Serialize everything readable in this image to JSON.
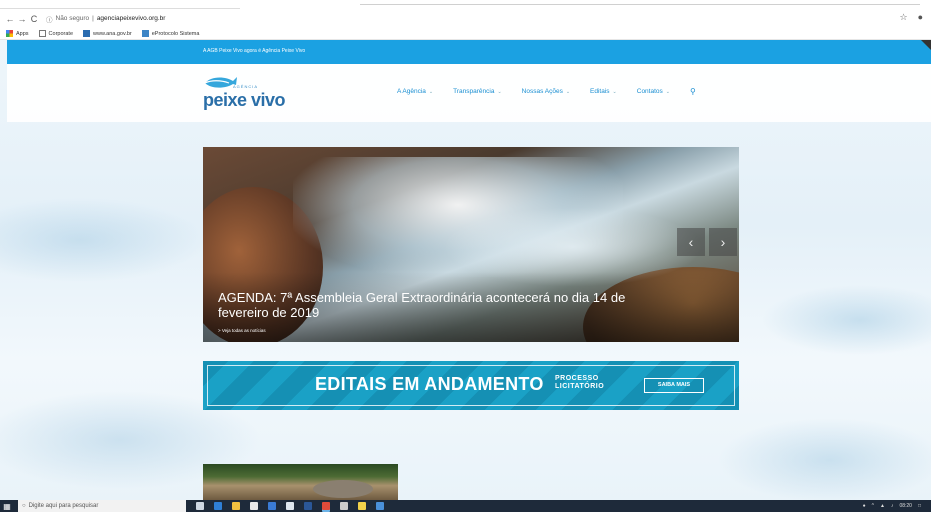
{
  "browser": {
    "nav": {
      "back": "←",
      "forward": "→",
      "reload": "C"
    },
    "security_label": "Não seguro",
    "url": "agenciapeixevivo.org.br",
    "right_icons": [
      "star-icon",
      "profile-icon"
    ],
    "bookmarks": [
      {
        "label": "Apps",
        "icon": "apps-grid-icon",
        "color": "#e94235"
      },
      {
        "label": "Corporate",
        "icon": "page-icon",
        "color": "#777777"
      },
      {
        "label": "www.ana.gov.br",
        "icon": "ana-icon",
        "color": "#2b6cb0"
      },
      {
        "label": "eProtocolo Sistema",
        "icon": "eprotocolo-icon",
        "color": "#3d85c6"
      }
    ]
  },
  "site": {
    "topbar_message": "A AGB Peixe Vivo agora é Agência Peixe Vivo",
    "logo": {
      "small": "AGÊNCIA",
      "name": "peixe vivo"
    },
    "nav": [
      {
        "label": "A Agência",
        "chevron": "⌄"
      },
      {
        "label": "Transparência",
        "chevron": "⌄"
      },
      {
        "label": "Nossas Ações",
        "chevron": "⌄"
      },
      {
        "label": "Editais",
        "chevron": "⌄"
      },
      {
        "label": "Contatos",
        "chevron": "⌄"
      }
    ],
    "slider": {
      "caption": "AGENDA: 7ª Assembleia Geral Extraordinária acontecerá no dia 14 de fevereiro de 2019",
      "more_link": "> Veja todas as notícias",
      "prev": "‹",
      "next": "›"
    },
    "banner": {
      "title": "EDITAIS EM ANDAMENTO",
      "subtitle_line1": "PROCESSO",
      "subtitle_line2": "LICITATÓRIO",
      "button": "SAIBA MAIS"
    }
  },
  "taskbar": {
    "search_placeholder": "Digite aqui para pesquisar",
    "apps": [
      {
        "name": "task-view",
        "color": "#cfd8e3"
      },
      {
        "name": "edge",
        "color": "#2f7fd6"
      },
      {
        "name": "explorer",
        "color": "#f0c040"
      },
      {
        "name": "store",
        "color": "#e8e8e8"
      },
      {
        "name": "outlook",
        "color": "#3a7bd5"
      },
      {
        "name": "skype",
        "color": "#dfe7ef"
      },
      {
        "name": "word",
        "color": "#2b5797"
      },
      {
        "name": "chrome",
        "color": "#e04b3a"
      },
      {
        "name": "calculator",
        "color": "#cccccc"
      },
      {
        "name": "notes",
        "color": "#f2d24b"
      },
      {
        "name": "remote",
        "color": "#4a90d9"
      }
    ],
    "time": "08:20",
    "colors": {
      "accent": "#1ba1e2",
      "nav": "#1b8fd2",
      "banner": "#1590b4"
    }
  }
}
